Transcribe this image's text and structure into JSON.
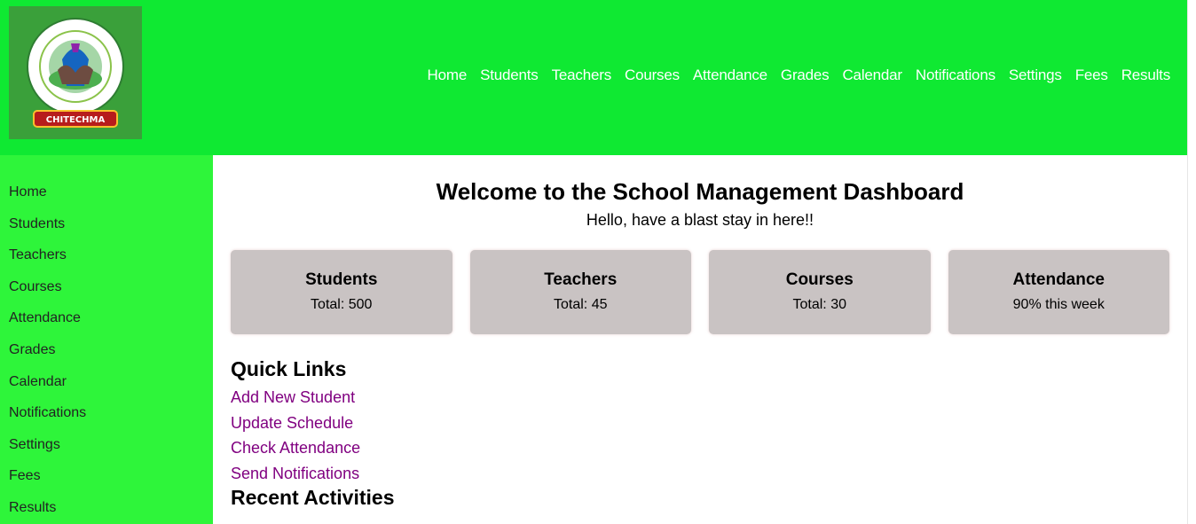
{
  "header": {
    "logo_alt": "CHARTERED HIGHER INSTITUTE OF TECHNOLOGY AND MANAGEMENT — CHITECHMA",
    "nav": [
      {
        "label": "Home"
      },
      {
        "label": "Students"
      },
      {
        "label": "Teachers"
      },
      {
        "label": "Courses"
      },
      {
        "label": "Attendance"
      },
      {
        "label": "Grades"
      },
      {
        "label": "Calendar"
      },
      {
        "label": "Notifications"
      },
      {
        "label": "Settings"
      },
      {
        "label": "Fees"
      },
      {
        "label": "Results"
      }
    ]
  },
  "sidebar": {
    "items": [
      {
        "label": "Home"
      },
      {
        "label": "Students"
      },
      {
        "label": "Teachers"
      },
      {
        "label": "Courses"
      },
      {
        "label": "Attendance"
      },
      {
        "label": "Grades"
      },
      {
        "label": "Calendar"
      },
      {
        "label": "Notifications"
      },
      {
        "label": "Settings"
      },
      {
        "label": "Fees"
      },
      {
        "label": "Results"
      }
    ]
  },
  "main": {
    "title": "Welcome to the School Management Dashboard",
    "subtitle": "Hello, have a blast stay in here!!",
    "cards": [
      {
        "title": "Students",
        "value": "Total: 500"
      },
      {
        "title": "Teachers",
        "value": "Total: 45"
      },
      {
        "title": "Courses",
        "value": "Total: 30"
      },
      {
        "title": "Attendance",
        "value": "90% this week"
      }
    ],
    "quick_links_title": "Quick Links",
    "quick_links": [
      {
        "label": "Add New Student"
      },
      {
        "label": "Update Schedule"
      },
      {
        "label": "Check Attendance"
      },
      {
        "label": "Send Notifications"
      }
    ],
    "recent_activities_title": "Recent Activities"
  },
  "colors": {
    "header_bg": "#0fe932",
    "sidebar_bg": "#2ef53a",
    "card_bg": "#c9c3c3",
    "link_color": "#800080"
  }
}
